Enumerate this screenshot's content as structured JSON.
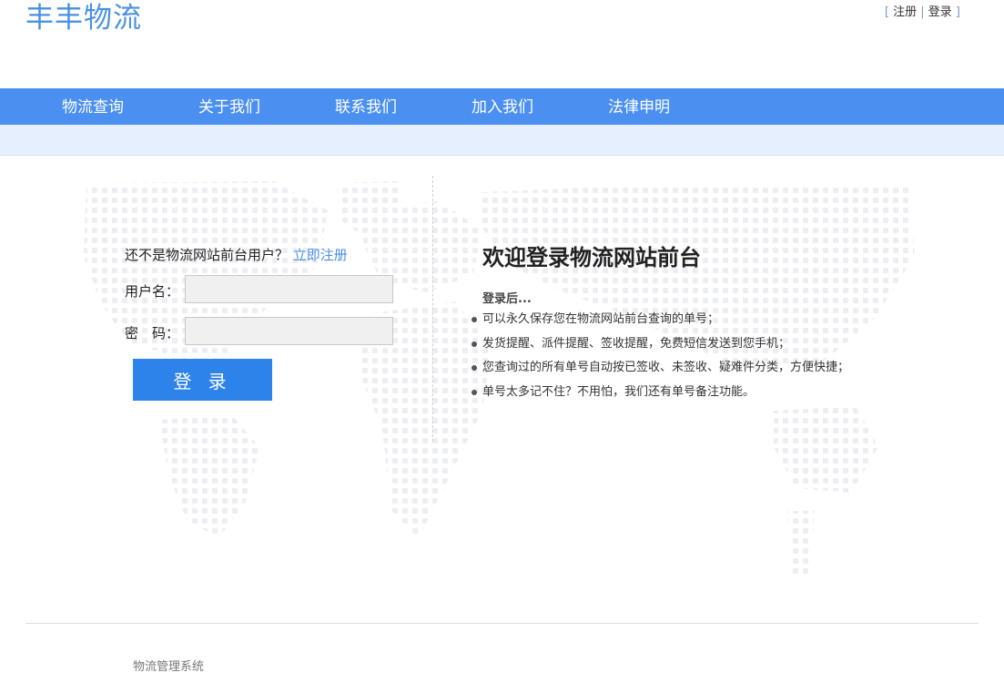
{
  "header": {
    "logo_text": "丰丰物流",
    "links": {
      "register": "注册",
      "login": "登录",
      "sep_open": "[",
      "sep_mid": "|",
      "sep_close": "]"
    }
  },
  "nav": {
    "items": [
      {
        "label": "物流查询"
      },
      {
        "label": "关于我们"
      },
      {
        "label": "联系我们"
      },
      {
        "label": "加入我们"
      },
      {
        "label": "法律申明"
      }
    ]
  },
  "login_form": {
    "tip_text": "还不是物流网站前台用户？",
    "tip_link": "立即注册",
    "username_label": "用户名：",
    "password_label": "密　码：",
    "username_value": "",
    "password_value": "",
    "submit_label": "登 录"
  },
  "welcome": {
    "title": "欢迎登录物流网站前台",
    "subtitle": "登录后...",
    "benefits": [
      "可以永久保存您在物流网站前台查询的单号；",
      "发货提醒、派件提醒、签收提醒，免费短信发送到您手机；",
      "您查询过的所有单号自动按已签收、未签收、疑难件分类，方便快捷；",
      "单号太多记不住？不用怕，我们还有单号备注功能。"
    ]
  },
  "footer": {
    "text": "物流管理系统"
  },
  "colors": {
    "brand_blue": "#4b90f0",
    "button_blue": "#2e83ea",
    "link_blue": "#4a90e2",
    "subbar_bg": "#e6effd",
    "map_dot": "#eef0f4"
  }
}
